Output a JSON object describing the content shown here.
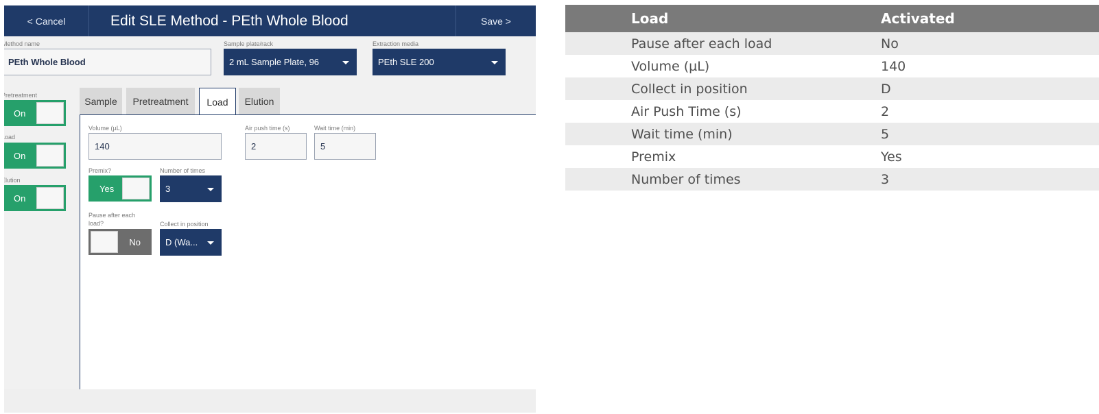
{
  "app": {
    "header": {
      "cancel_label": "< Cancel",
      "title": "Edit SLE Method - PEth Whole Blood",
      "save_label": "Save >"
    },
    "method_name": {
      "label": "Method name",
      "value": "PEth Whole Blood"
    },
    "sample_plate": {
      "label": "Sample plate/rack",
      "value": "2 mL Sample Plate, 96"
    },
    "extraction_media": {
      "label": "Extraction media",
      "value": "PEth SLE 200"
    },
    "sidebar": {
      "pretreatment": {
        "label": "Pretreatment",
        "state": "On"
      },
      "load": {
        "label": "Load",
        "state": "On"
      },
      "elution": {
        "label": "Elution",
        "state": "On"
      }
    },
    "tabs": [
      {
        "label": "Sample",
        "active": false
      },
      {
        "label": "Pretreatment",
        "active": false
      },
      {
        "label": "Load",
        "active": true
      },
      {
        "label": "Elution",
        "active": false
      }
    ],
    "load_form": {
      "volume": {
        "label": "Volume (µL)",
        "value": "140"
      },
      "air_push_time": {
        "label": "Air push time (s)",
        "value": "2"
      },
      "wait_time": {
        "label": "Wait time (min)",
        "value": "5"
      },
      "premix": {
        "label": "Premix?",
        "state": "Yes"
      },
      "number_of_times": {
        "label": "Number of times",
        "value": "3"
      },
      "pause_after_each_load": {
        "label_line1": "Pause after each",
        "label_line2": "load?",
        "state": "No"
      },
      "collect_in_position": {
        "label": "Collect in position",
        "value": "D (Wa..."
      }
    }
  },
  "summary_table": {
    "headers": [
      "Load",
      "Activated"
    ],
    "rows": [
      [
        "Pause after each load",
        "No"
      ],
      [
        "Volume (µL)",
        "140"
      ],
      [
        "Collect in position",
        "D"
      ],
      [
        "Air Push Time (s)",
        "2"
      ],
      [
        "Wait time (min)",
        "5"
      ],
      [
        "Premix",
        "Yes"
      ],
      [
        "Number of times",
        "3"
      ]
    ]
  },
  "colors": {
    "header_navy": "#1f3a68",
    "toggle_green": "#26a06b",
    "toggle_gray": "#6d6d6d",
    "table_header_gray": "#7a7a7a"
  }
}
